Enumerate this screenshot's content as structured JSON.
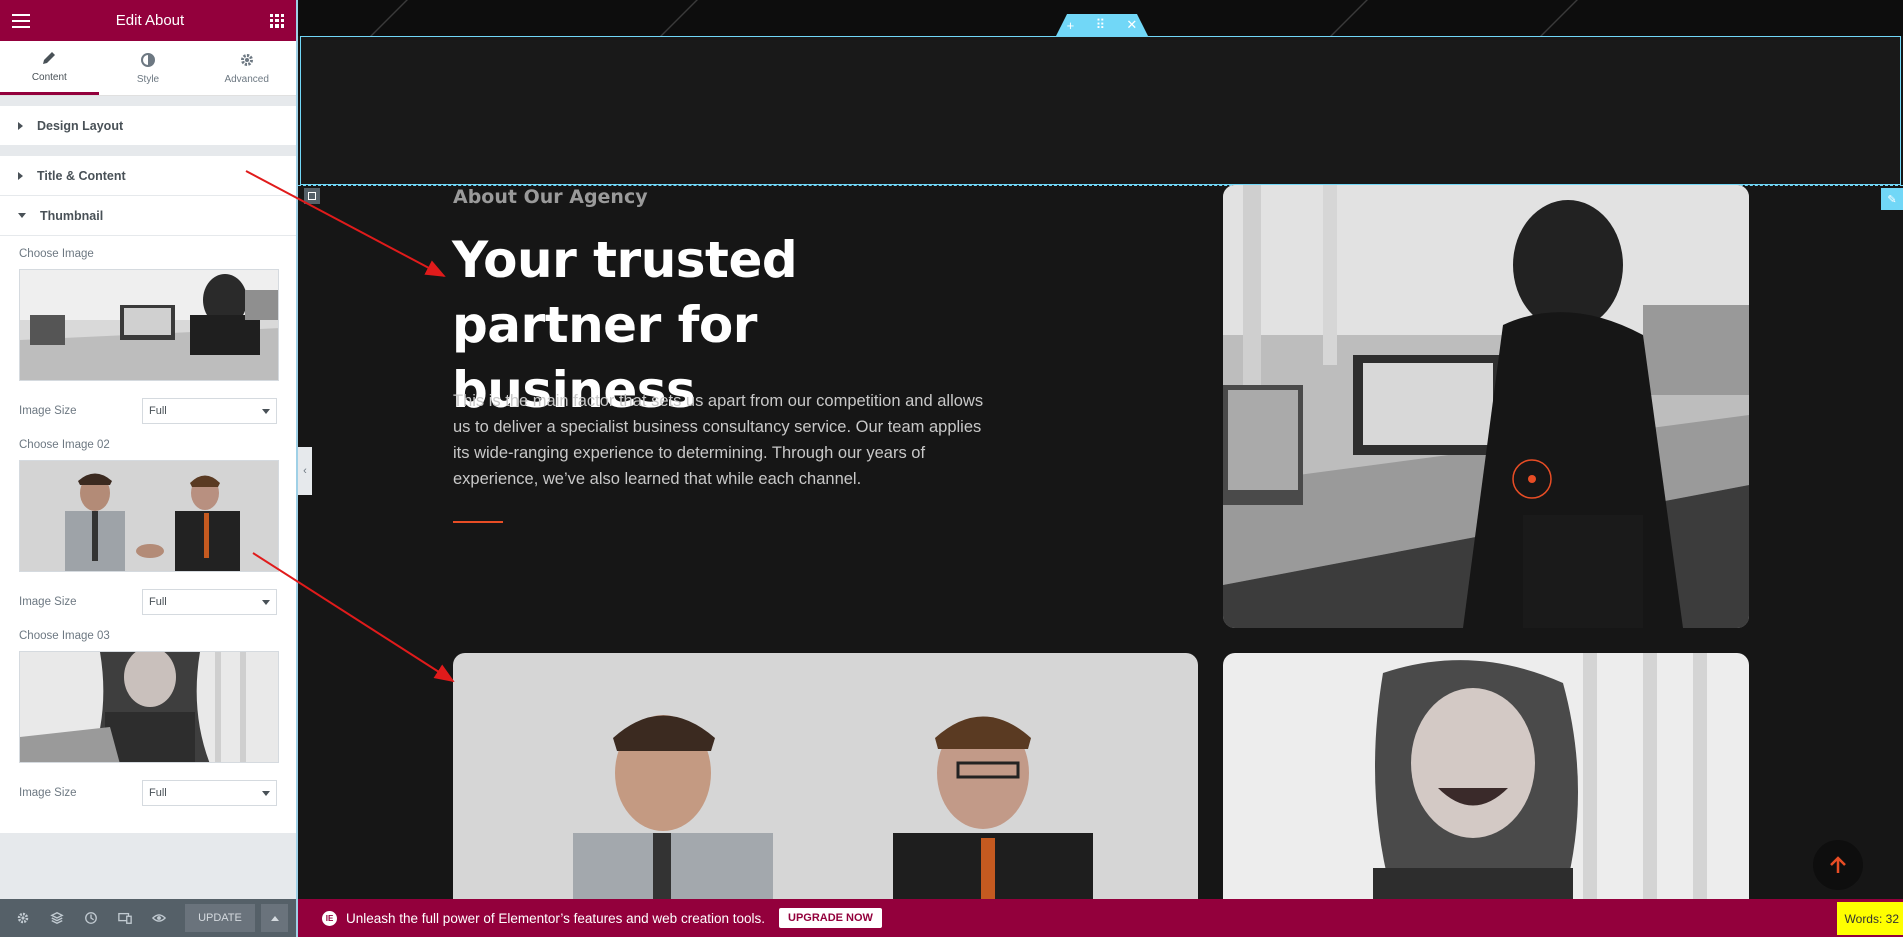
{
  "panel": {
    "title": "Edit About",
    "tabs": [
      {
        "label": "Content",
        "icon": "pencil-icon",
        "active": true
      },
      {
        "label": "Style",
        "icon": "contrast-icon"
      },
      {
        "label": "Advanced",
        "icon": "gear-icon"
      }
    ],
    "sections": {
      "design_layout": "Design Layout",
      "title_content": "Title & Content",
      "thumbnail": "Thumbnail"
    },
    "thumbnail": {
      "choose_image": "Choose Image",
      "choose_image_02": "Choose Image 02",
      "choose_image_03": "Choose Image 03",
      "image_size_label": "Image Size",
      "image_size_value": "Full"
    },
    "footer": {
      "update_label": "UPDATE"
    }
  },
  "preview": {
    "subtitle": "About Our Agency",
    "title": "Your trusted partner for business",
    "body": "This is the main factor that sets us apart from our competition and allows us to deliver a specialist business consultancy service. Our team applies its wide-ranging experience to determining. Through our years of experience, we’ve also learned that while each channel."
  },
  "promo": {
    "message": "Unleash the full power of Elementor’s features and web creation tools.",
    "upgrade_label": "UPGRADE NOW"
  },
  "words_badge": "Words: 32",
  "colors": {
    "brand": "#93003c",
    "accent": "#e84d25",
    "editor_cyan": "#71d7f7"
  }
}
